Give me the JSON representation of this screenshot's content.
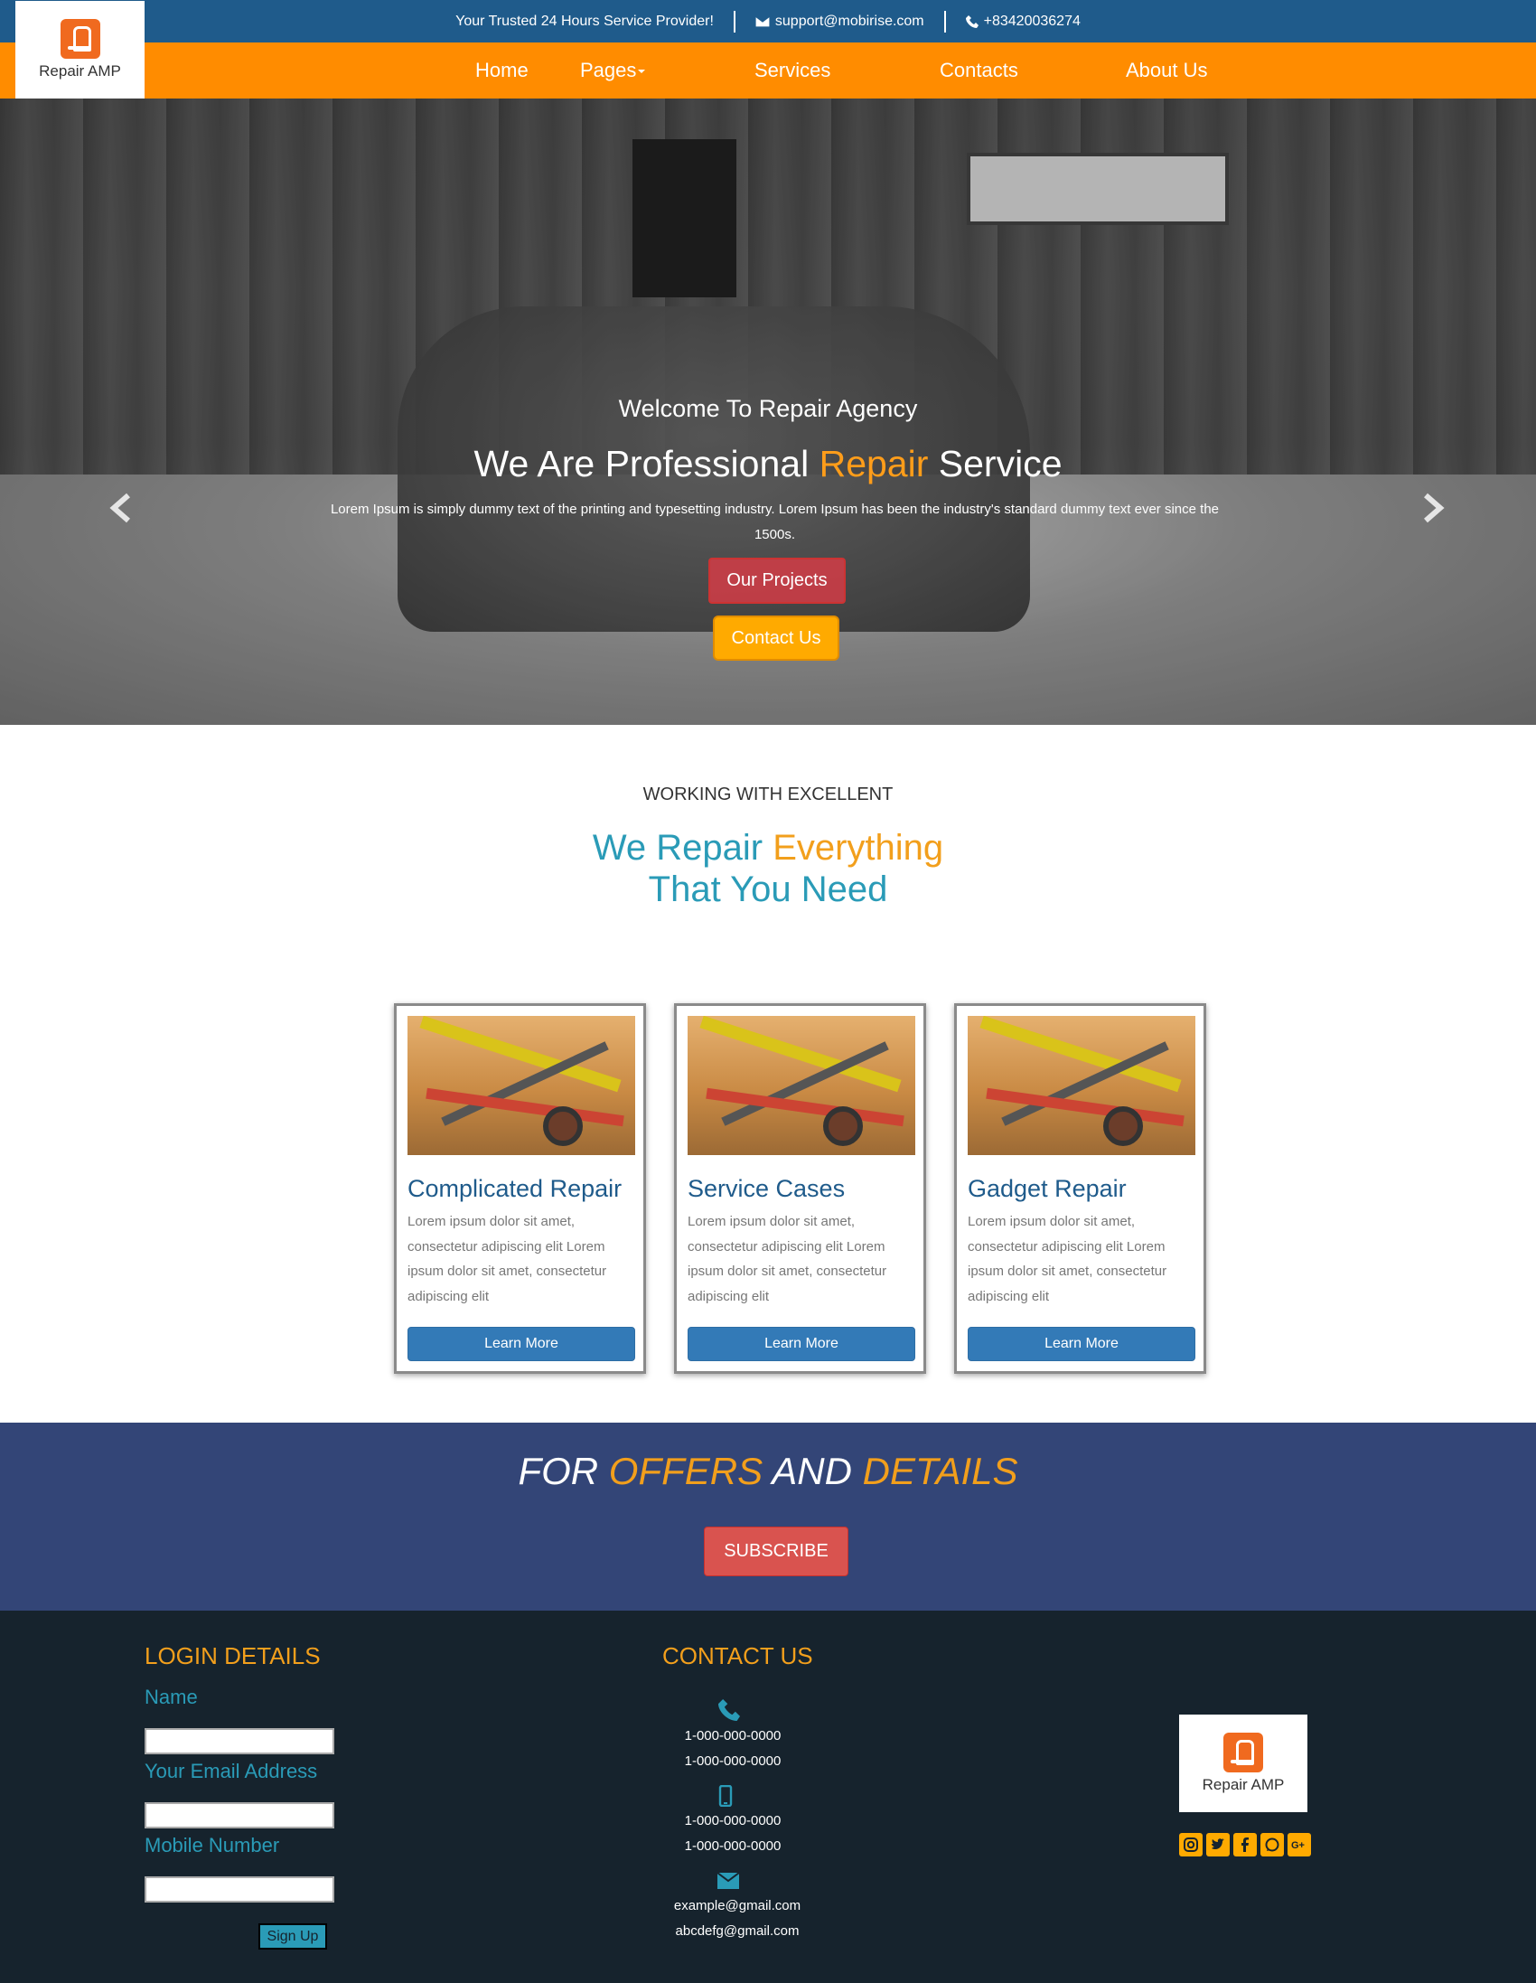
{
  "topbar": {
    "tagline": "Your Trusted 24 Hours Service Provider!",
    "email": "support@mobirise.com",
    "phone": "+83420036274"
  },
  "brand": {
    "logo_text": "Repair AMP"
  },
  "nav": {
    "items": [
      "Home",
      "Pages",
      "Services",
      "Contacts",
      "About Us"
    ]
  },
  "hero": {
    "welcome": "Welcome To Repair Agency",
    "title_part1": "We Are Professional",
    "title_accent": "Repair",
    "title_part2": "Service",
    "lorem": "Lorem Ipsum is simply dummy text of the printing and typesetting industry. Lorem Ipsum has been the industry's standard dummy text ever since the 1500s.",
    "btn_projects": "Our Projects",
    "btn_contact": "Contact Us",
    "slide_count": 3,
    "active_slide": 3
  },
  "intro": {
    "eyebrow": "WORKING WITH EXCELLENT",
    "headline_part1": "We Repair",
    "headline_accent": "Everything",
    "headline_part2": "That You Need"
  },
  "cards": [
    {
      "title": "Complicated Repair",
      "text": "Lorem ipsum dolor sit amet, consectetur adipiscing elit Lorem ipsum dolor sit amet, consectetur adipiscing elit",
      "button": "Learn More"
    },
    {
      "title": "Service Cases",
      "text": "Lorem ipsum dolor sit amet, consectetur adipiscing elit Lorem ipsum dolor sit amet, consectetur adipiscing elit",
      "button": "Learn More"
    },
    {
      "title": "Gadget Repair",
      "text": "Lorem ipsum dolor sit amet, consectetur adipiscing elit Lorem ipsum dolor sit amet, consectetur adipiscing elit",
      "button": "Learn More"
    }
  ],
  "offers": {
    "word1": "FOR",
    "word2": "OFFERS",
    "word3": "AND",
    "word4": "DETAILS",
    "button": "SUBSCRIBE"
  },
  "footer": {
    "login_title": "LOGIN DETAILS",
    "name_label": "Name",
    "email_label": "Your Email Address",
    "mobile_label": "Mobile Number",
    "signup": "Sign Up",
    "contact_title": "CONTACT US",
    "phones": [
      "1-000-000-0000",
      "1-000-000-0000"
    ],
    "mobiles": [
      "1-000-000-0000",
      "1-000-000-0000"
    ],
    "emails": [
      "example@gmail.com",
      "abcdefg@gmail.com"
    ],
    "logo_text": "Repair AMP",
    "socials": [
      "instagram-icon",
      "twitter-icon",
      "facebook-icon",
      "whatsapp-icon",
      "google-plus-icon"
    ]
  },
  "colors": {
    "topbar": "#1f5b8b",
    "nav": "#ff8c00",
    "accent_orange": "#f29f1c",
    "teal": "#2a9bb7",
    "offers_bg": "#334577",
    "footer_bg": "#16232d",
    "subscribe": "#d9534f",
    "learn_more": "#337ab7"
  }
}
